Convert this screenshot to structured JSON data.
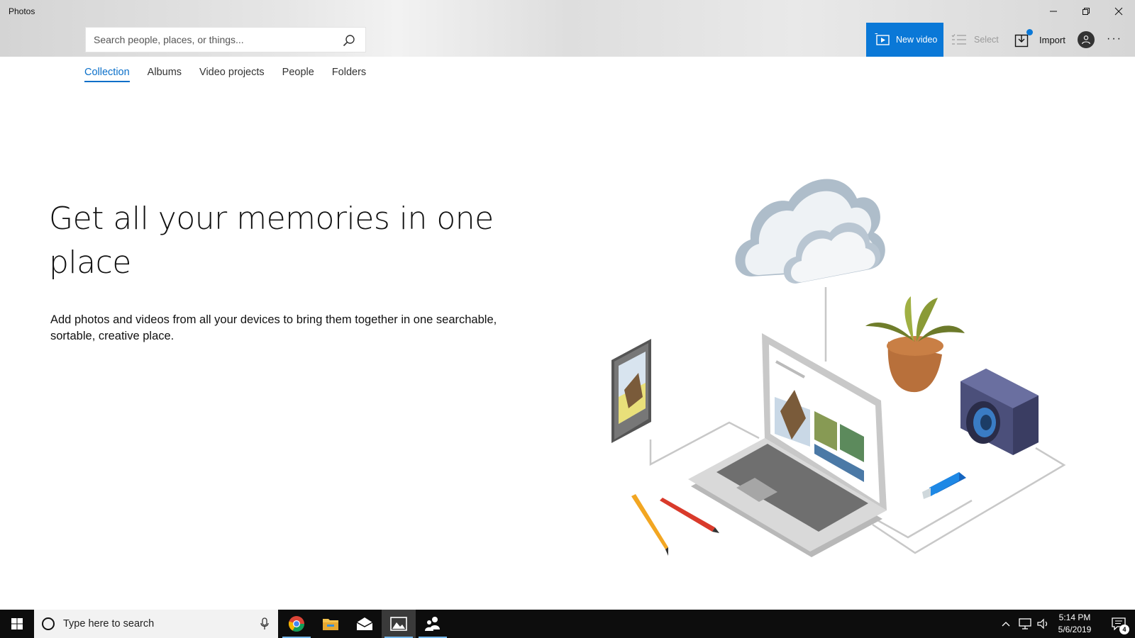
{
  "window": {
    "title": "Photos"
  },
  "search": {
    "placeholder": "Search people, places, or things..."
  },
  "toolbar": {
    "new_video_label": "New video",
    "select_label": "Select",
    "import_label": "Import"
  },
  "tabs": [
    {
      "label": "Collection",
      "active": true
    },
    {
      "label": "Albums",
      "active": false
    },
    {
      "label": "Video projects",
      "active": false
    },
    {
      "label": "People",
      "active": false
    },
    {
      "label": "Folders",
      "active": false
    }
  ],
  "hero": {
    "title": "Get all your memories in one place",
    "description": "Add photos and videos from all your devices to bring them together in one searchable, sortable, creative place."
  },
  "taskbar": {
    "search_placeholder": "Type here to search",
    "apps": [
      "chrome-icon",
      "file-explorer-icon",
      "mail-icon",
      "photos-icon",
      "people-icon"
    ],
    "time": "5:14 PM",
    "date": "5/6/2019",
    "notification_count": "4"
  },
  "colors": {
    "accent": "#0a78d7",
    "tab_active": "#0a6fc9",
    "taskbar": "#0d0d0d"
  }
}
